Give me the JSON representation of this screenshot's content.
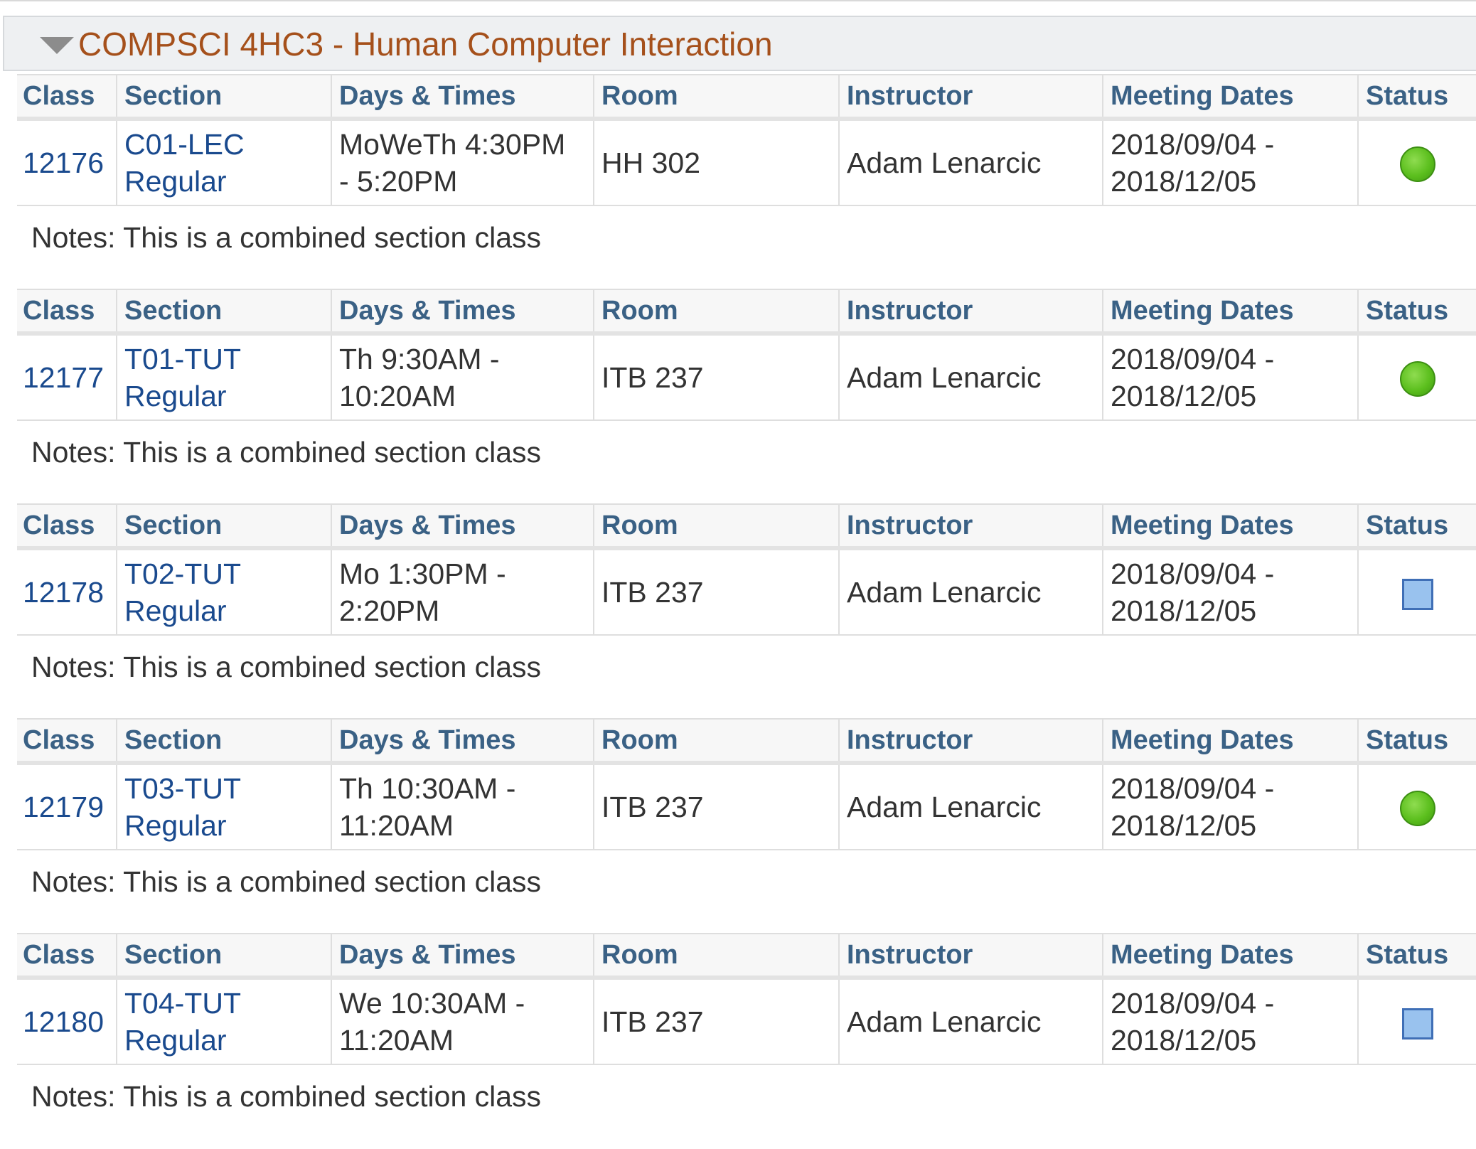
{
  "course": {
    "title": "COMPSCI 4HC3 - Human Computer Interaction",
    "expanded": true
  },
  "columns": {
    "class": "Class",
    "section": "Section",
    "days_times": "Days & Times",
    "room": "Room",
    "instructor": "Instructor",
    "meeting_dates": "Meeting Dates",
    "status": "Status"
  },
  "status_legend": {
    "open": {
      "icon": "green-circle-icon",
      "color": "#5cbf1e"
    },
    "closed": {
      "icon": "blue-square-icon",
      "color": "#99c2ee"
    }
  },
  "sections": [
    {
      "class_nbr": "12176",
      "section_code": "C01-LEC",
      "section_type": "Regular",
      "days_times_line1": "MoWeTh 4:30PM",
      "days_times_line2": "- 5:20PM",
      "room": "HH 302",
      "instructor": "Adam Lenarcic",
      "dates_line1": "2018/09/04 -",
      "dates_line2": "2018/12/05",
      "status": "open",
      "notes": "Notes: This is a combined section class"
    },
    {
      "class_nbr": "12177",
      "section_code": "T01-TUT",
      "section_type": "Regular",
      "days_times_line1": "Th 9:30AM -",
      "days_times_line2": "10:20AM",
      "room": "ITB 237",
      "instructor": "Adam Lenarcic",
      "dates_line1": "2018/09/04 -",
      "dates_line2": "2018/12/05",
      "status": "open",
      "notes": "Notes: This is a combined section class"
    },
    {
      "class_nbr": "12178",
      "section_code": "T02-TUT",
      "section_type": "Regular",
      "days_times_line1": "Mo 1:30PM -",
      "days_times_line2": "2:20PM",
      "room": "ITB 237",
      "instructor": "Adam Lenarcic",
      "dates_line1": "2018/09/04 -",
      "dates_line2": "2018/12/05",
      "status": "closed",
      "notes": "Notes: This is a combined section class"
    },
    {
      "class_nbr": "12179",
      "section_code": "T03-TUT",
      "section_type": "Regular",
      "days_times_line1": "Th 10:30AM -",
      "days_times_line2": "11:20AM",
      "room": "ITB 237",
      "instructor": "Adam Lenarcic",
      "dates_line1": "2018/09/04 -",
      "dates_line2": "2018/12/05",
      "status": "open",
      "notes": "Notes: This is a combined section class"
    },
    {
      "class_nbr": "12180",
      "section_code": "T04-TUT",
      "section_type": "Regular",
      "days_times_line1": "We 10:30AM -",
      "days_times_line2": "11:20AM",
      "room": "ITB 237",
      "instructor": "Adam Lenarcic",
      "dates_line1": "2018/09/04 -",
      "dates_line2": "2018/12/05",
      "status": "closed",
      "notes": "Notes: This is a combined section class"
    }
  ]
}
